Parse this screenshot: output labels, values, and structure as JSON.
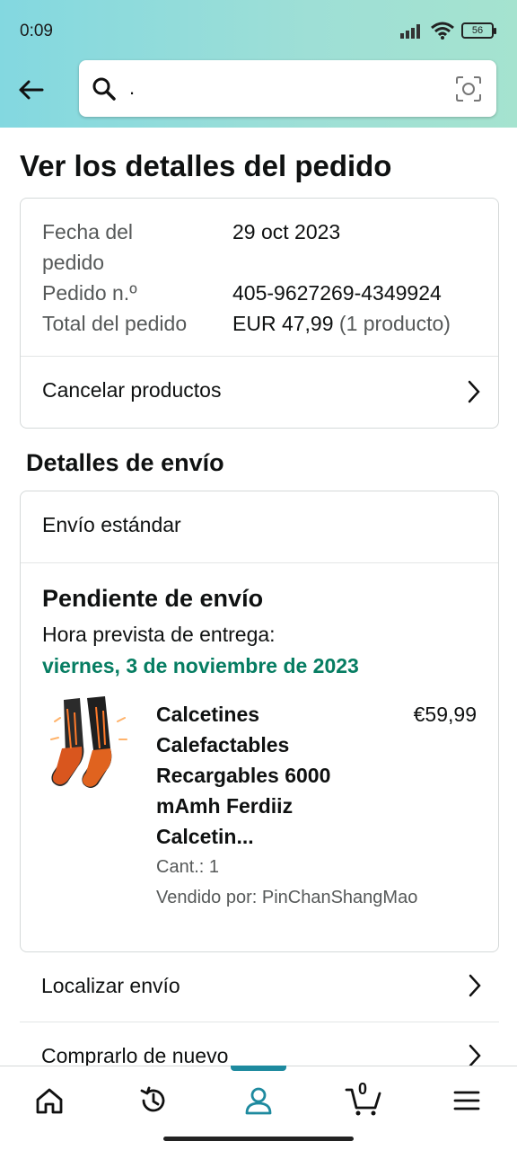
{
  "status": {
    "time": "0:09",
    "battery": "56"
  },
  "search": {
    "value": "."
  },
  "page_title": "Ver los detalles del pedido",
  "order_info": {
    "date_label_line1": "Fecha del",
    "date_label_line2": "pedido",
    "date_value": "29 oct 2023",
    "number_label": "Pedido n.º",
    "number_value": "405-9627269-4349924",
    "total_label": "Total del pedido",
    "total_value": "EUR 47,99",
    "total_count": " (1 producto)",
    "cancel_label": "Cancelar productos"
  },
  "shipping": {
    "section_title": "Detalles de envío",
    "method": "Envío estándar",
    "status": "Pendiente de envío",
    "eta_label": "Hora prevista de entrega:",
    "eta_date": "viernes, 3 de noviembre de 2023",
    "product": {
      "name_lines": [
        "Calcetines",
        "Calefactables",
        "Recargables 6000",
        "mAmh Ferdiiz",
        "Calcetin..."
      ],
      "price": "€59,99",
      "qty": "Cant.: 1",
      "seller": "Vendido por: PinChanShangMao"
    }
  },
  "actions": {
    "track": "Localizar envío",
    "buy_again": "Comprarlo de nuevo"
  },
  "nav": {
    "cart_count": "0",
    "active": "account",
    "accent_color": "#1e8a9f"
  },
  "colors": {
    "eta": "#067d62",
    "header_start": "#83d8e0",
    "header_end": "#a5e3cf"
  }
}
